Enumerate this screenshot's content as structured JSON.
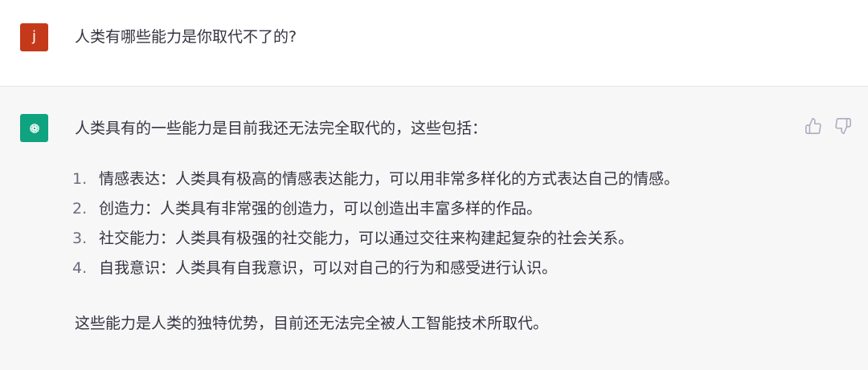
{
  "user_message": {
    "avatar_letter": "j",
    "avatar_color": "#c5391b",
    "text": "人类有哪些能力是你取代不了的?"
  },
  "assistant_message": {
    "avatar_icon": "openai-logo-icon",
    "avatar_color": "#10a37f",
    "intro": "人类具有的一些能力是目前我还无法完全取代的，这些包括：",
    "list": [
      {
        "num": "1.",
        "text": "情感表达：人类具有极高的情感表达能力，可以用非常多样化的方式表达自己的情感。"
      },
      {
        "num": "2.",
        "text": "创造力：人类具有非常强的创造力，可以创造出丰富多样的作品。"
      },
      {
        "num": "3.",
        "text": "社交能力：人类具有极强的社交能力，可以通过交往来构建起复杂的社会关系。"
      },
      {
        "num": "4.",
        "text": "自我意识：人类具有自我意识，可以对自己的行为和感受进行认识。"
      }
    ],
    "outro": "这些能力是人类的独特优势，目前还无法完全被人工智能技术所取代。",
    "actions": [
      {
        "icon": "thumbs-up-icon"
      },
      {
        "icon": "thumbs-down-icon"
      }
    ]
  }
}
